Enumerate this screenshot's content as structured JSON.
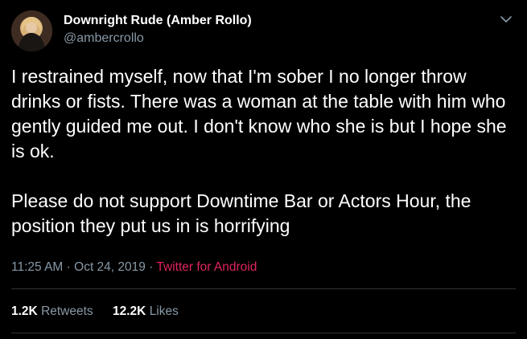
{
  "user": {
    "display_name": "Downright Rude (Amber Rollo)",
    "handle": "@ambercrollo"
  },
  "tweet": {
    "paragraphs": [
      "I restrained myself, now that I'm sober I no longer throw drinks or fists. There was a woman at the table with him who gently guided me out. I don't know who she is but I hope she is ok.",
      "Please do not support Downtime Bar or Actors Hour, the position they put us in is horrifying"
    ],
    "time": "11:25 AM",
    "separator": "·",
    "date": "Oct 24, 2019",
    "source": "Twitter for Android"
  },
  "stats": {
    "retweets_count": "1.2K",
    "retweets_label": "Retweets",
    "likes_count": "12.2K",
    "likes_label": "Likes"
  },
  "icons": {
    "menu": "chevron-down-icon"
  },
  "colors": {
    "background": "#000000",
    "muted": "#8899a6",
    "source_link": "#e0245e",
    "divider": "#2f3336"
  }
}
